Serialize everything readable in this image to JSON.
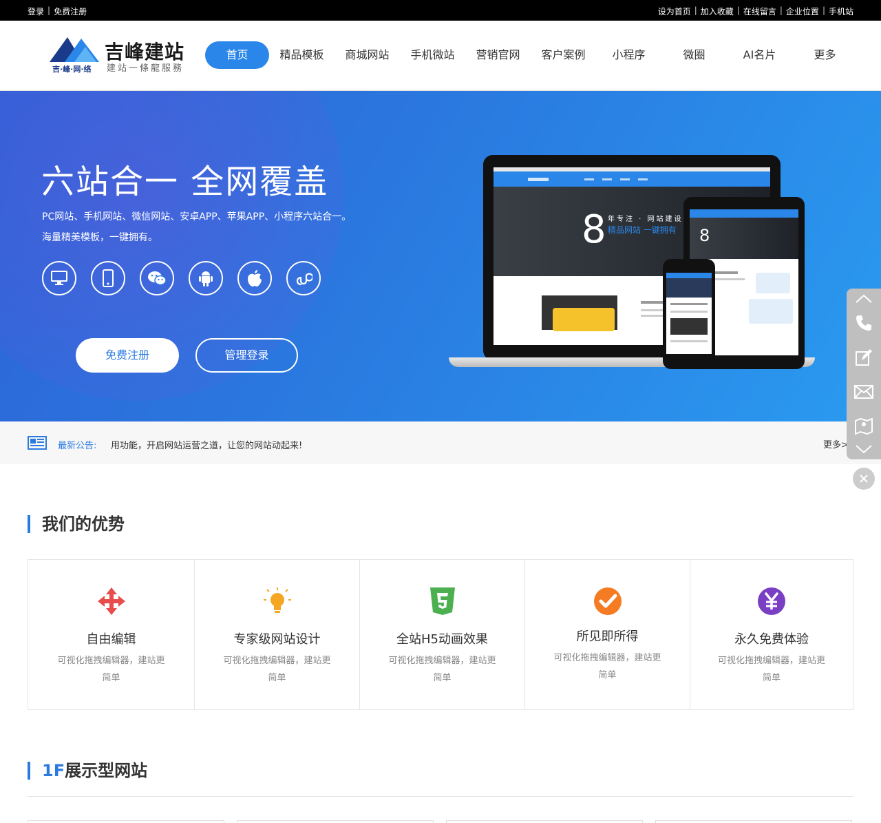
{
  "topbar": {
    "login": "登录",
    "register": "免费注册",
    "links": [
      "设为首页",
      "加入收藏",
      "在线留言",
      "企业位置",
      "手机站"
    ]
  },
  "logo": {
    "brand": "吉峰建站",
    "slogan": "建站一條龍服務",
    "sub": "吉·峰·网·络"
  },
  "nav": {
    "items": [
      "首页",
      "精品模板",
      "商城网站",
      "手机微站",
      "营销官网",
      "客户案例",
      "小程序",
      "微圈",
      "AI名片",
      "更多"
    ],
    "active_index": 0
  },
  "banner": {
    "title": "六站合一  全网覆盖",
    "desc_line1": "PC网站、手机网站、微信网站、安卓APP、苹果APP、小程序六站合一。",
    "desc_line2": "海量精美模板，一键拥有。",
    "icons": [
      "desktop-icon",
      "mobile-icon",
      "wechat-icon",
      "android-icon",
      "apple-icon",
      "mini-program-icon"
    ],
    "register_btn": "免费注册",
    "login_btn": "管理登录",
    "device_big_number": "8",
    "device_line1": "年专注 · 网站建设",
    "device_line2": "精品网站 一键拥有",
    "device_tablet_number": "8"
  },
  "notice": {
    "label": "最新公告:",
    "text": "用功能，开启网站运营之道，让您的网站动起来!",
    "more": "更多>"
  },
  "advantages": {
    "title": "我们的优势",
    "items": [
      {
        "title": "自由编辑",
        "desc": "可视化拖拽编辑器，建站更简单",
        "icon": "move-arrows-icon",
        "color": "#e84c4c"
      },
      {
        "title": "专家级网站设计",
        "desc": "可视化拖拽编辑器，建站更简单",
        "icon": "light-bulb-icon",
        "color": "#f5a623"
      },
      {
        "title": "全站H5动画效果",
        "desc": "可视化拖拽编辑器，建站更简单",
        "icon": "html5-icon",
        "color": "#4caf50"
      },
      {
        "title": "所见即所得",
        "desc": "可视化拖拽编辑器，建站更简单",
        "icon": "check-circle-icon",
        "color": "#f57c22"
      },
      {
        "title": "永久免费体验",
        "desc": "可视化拖拽编辑器，建站更简单",
        "icon": "yuan-circle-icon",
        "color": "#7b3fc4"
      }
    ]
  },
  "floor1": {
    "prefix": "1F",
    "title": "展示型网站"
  },
  "colors": {
    "accent": "#2a7ae0",
    "topbar": "#000000"
  }
}
